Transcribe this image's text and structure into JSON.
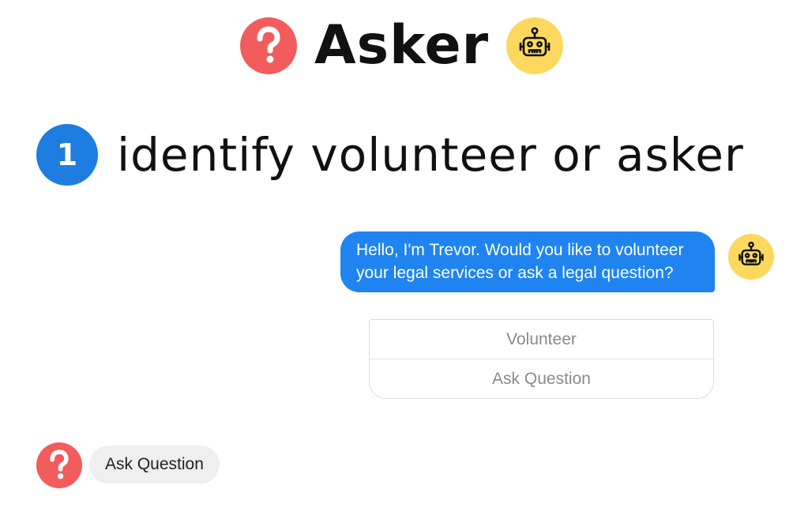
{
  "header": {
    "title": "Asker",
    "left_icon": "question-icon",
    "right_icon": "robot-icon"
  },
  "step": {
    "number": "1",
    "text": "identify volunteer or asker"
  },
  "bot_message": {
    "text": "Hello, I'm Trevor. Would you like to volunteer your legal services or ask a legal question?",
    "avatar_icon": "robot-icon"
  },
  "quick_replies": [
    {
      "label": "Volunteer"
    },
    {
      "label": "Ask Question"
    }
  ],
  "user_reply": {
    "text": "Ask Question",
    "avatar_icon": "question-icon"
  },
  "colors": {
    "question_badge": "#f25c5c",
    "robot_badge": "#fcd95e",
    "step_badge": "#1e7de0",
    "bot_bubble": "#1f84f0",
    "user_bubble": "#efefef"
  }
}
